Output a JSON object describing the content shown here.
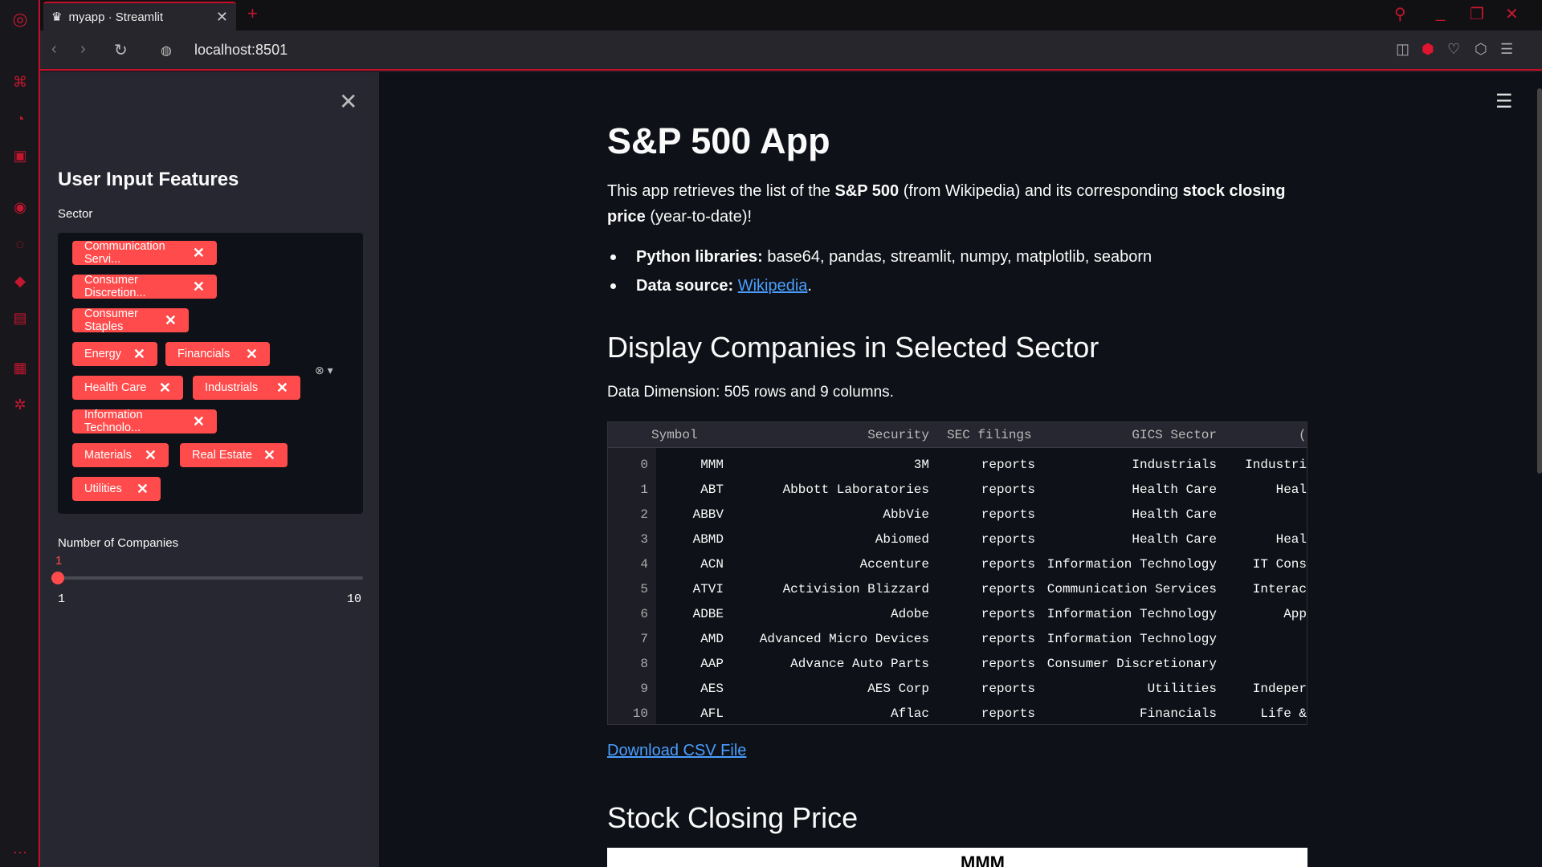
{
  "browser": {
    "tab_title": "myapp · Streamlit",
    "url": "localhost:8501"
  },
  "sidebar": {
    "title": "User Input Features",
    "sector_label": "Sector",
    "chips": [
      "Communication Servi...",
      "Consumer Discretion...",
      "Consumer Staples",
      "Energy",
      "Financials",
      "Health Care",
      "Industrials",
      "Information Technolo...",
      "Materials",
      "Real Estate",
      "Utilities"
    ],
    "num_companies_label": "Number of Companies",
    "slider_value": "1",
    "slider_min": "1",
    "slider_max": "10"
  },
  "main": {
    "title": "S&P 500 App",
    "intro": {
      "p1": "This app retrieves the list of the ",
      "b1": "S&P 500",
      "p2": " (from Wikipedia) and its corresponding ",
      "b2": "stock closing price",
      "p3": " (year-to-date)!"
    },
    "bullets": [
      {
        "label": "Python libraries:",
        "text": " base64, pandas, streamlit, numpy, matplotlib, seaborn"
      },
      {
        "label": "Data source:",
        "link": "Wikipedia",
        "after": "."
      }
    ],
    "section1": "Display Companies in Selected Sector",
    "dimension": "Data Dimension: 505 rows and 9 columns.",
    "table": {
      "headers": [
        "Symbol",
        "Security",
        "SEC filings",
        "GICS Sector",
        "("
      ],
      "rows": [
        [
          "0",
          "MMM",
          "3M",
          "reports",
          "Industrials",
          "Industri"
        ],
        [
          "1",
          "ABT",
          "Abbott Laboratories",
          "reports",
          "Health Care",
          "Heal"
        ],
        [
          "2",
          "ABBV",
          "AbbVie",
          "reports",
          "Health Care",
          ""
        ],
        [
          "3",
          "ABMD",
          "Abiomed",
          "reports",
          "Health Care",
          "Heal"
        ],
        [
          "4",
          "ACN",
          "Accenture",
          "reports",
          "Information Technology",
          "IT Cons"
        ],
        [
          "5",
          "ATVI",
          "Activision Blizzard",
          "reports",
          "Communication Services",
          "Interac"
        ],
        [
          "6",
          "ADBE",
          "Adobe",
          "reports",
          "Information Technology",
          "App"
        ],
        [
          "7",
          "AMD",
          "Advanced Micro Devices",
          "reports",
          "Information Technology",
          ""
        ],
        [
          "8",
          "AAP",
          "Advance Auto Parts",
          "reports",
          "Consumer Discretionary",
          ""
        ],
        [
          "9",
          "AES",
          "AES Corp",
          "reports",
          "Utilities",
          "Indeper"
        ],
        [
          "10",
          "AFL",
          "Aflac",
          "reports",
          "Financials",
          "Life &"
        ]
      ]
    },
    "download_link": "Download CSV File",
    "section2": "Stock Closing Price",
    "plot_title": "MMM"
  }
}
